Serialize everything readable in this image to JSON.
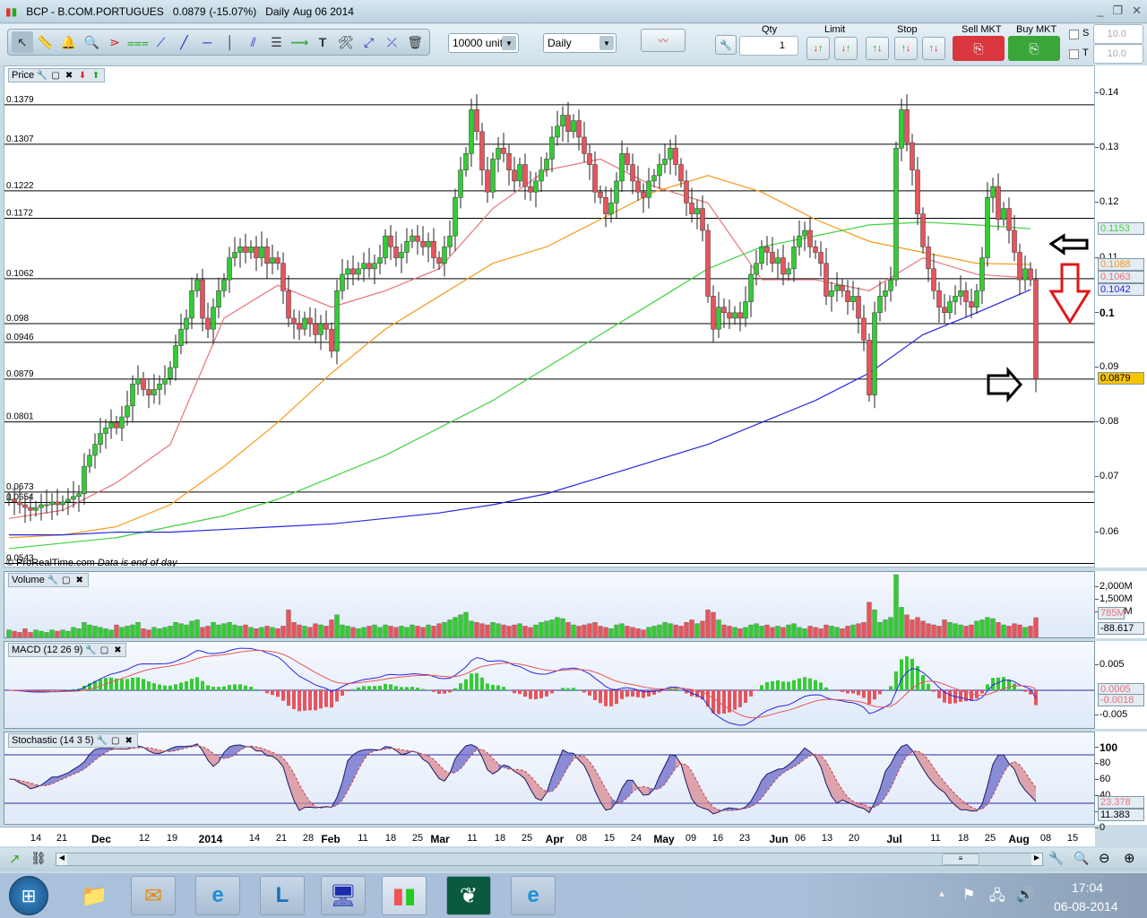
{
  "window": {
    "symbol": "BCP - B.COM.PORTUGUES",
    "last_price": "0.0879",
    "change": "(-15.07%)",
    "period": "Daily",
    "date": "Aug 06 2014",
    "controls": [
      "minimize",
      "restore",
      "close"
    ]
  },
  "toolbar": {
    "tools": [
      "pointer-icon",
      "ruler-icon",
      "alarm-bell-icon",
      "zoom-magnifier-icon",
      "fan-lines-icon",
      "channel-icon",
      "segment-icon",
      "line-icon",
      "horizontal-line-icon",
      "vertical-line-icon",
      "parallel-lines-icon",
      "fibonacci-icon",
      "trend-channel-icon",
      "text-icon",
      "tools-icon",
      "point-icon",
      "line-cross-icon",
      "trash-icon"
    ],
    "units": "10000 units",
    "timeframe": "Daily",
    "qty_label": "Qty",
    "qty_value": "1",
    "limit_label": "Limit",
    "stop_label": "Stop",
    "sell_label": "Sell MKT",
    "buy_label": "Buy MKT",
    "s_label": "S",
    "t_label": "T",
    "s_value": "10.0",
    "t_value": "10.0",
    "sell_color": "#d9363e",
    "buy_color": "#3aa63a"
  },
  "price_panel": {
    "title": "Price",
    "copyright": "© ProRealTime.com",
    "notice": "Data is end of day",
    "axis_ticks": [
      "0.14",
      "0.13",
      "0.12",
      "0.11",
      "0.1",
      "0.09",
      "0.08",
      "0.07",
      "0.06"
    ],
    "levels": [
      "0.1379",
      "0.1307",
      "0.1222",
      "0.1172",
      "0.1062",
      "0.098",
      "0.0946",
      "0.0879",
      "0.0801",
      "0.0673",
      "0.0654",
      "0.0543"
    ],
    "ma_tags": [
      {
        "value": "0.1153",
        "color": "#3fd43f"
      },
      {
        "value": "0.1088",
        "color": "#f59a1c"
      },
      {
        "value": "0.1063",
        "color": "#e8737a"
      },
      {
        "value": "0.1042",
        "color": "#2626e0"
      }
    ],
    "last_tag": "0.0879",
    "last_tag_color": "#f5c400"
  },
  "volume_panel": {
    "title": "Volume",
    "axis_ticks": [
      "2,000M",
      "1,500M",
      "1,000M"
    ],
    "tag_volume": "785M",
    "tag_value": "-88.617"
  },
  "macd_panel": {
    "title": "MACD (12 26 9)",
    "axis_ticks": [
      "0.005",
      "-0.005"
    ],
    "tag1": "0.0005",
    "tag2": "-0.0018"
  },
  "stoch_panel": {
    "title": "Stochastic (14 3 5)",
    "axis_ticks": [
      "100",
      "80",
      "60",
      "40",
      "20",
      "0"
    ],
    "tag1": "23.378",
    "tag2": "11.383"
  },
  "x_axis": {
    "labels": [
      "14",
      "21",
      "Dec",
      "12",
      "19",
      "2014",
      "14",
      "21",
      "28",
      "Feb",
      "11",
      "18",
      "25",
      "Mar",
      "11",
      "18",
      "25",
      "Apr",
      "08",
      "15",
      "24",
      "May",
      "09",
      "16",
      "23",
      "Jun",
      "06",
      "13",
      "20",
      "Jul",
      "11",
      "18",
      "25",
      "Aug",
      "08",
      "15"
    ]
  },
  "taskbar": {
    "apps": [
      "start-orb",
      "file-explorer",
      "outlook",
      "internet-explorer",
      "lync",
      "remote-terminal",
      "prorealtime",
      "app-green-leaf",
      "internet-explorer-2"
    ],
    "time": "17:04",
    "date": "06-08-2014"
  },
  "chart_data": {
    "type": "candlestick",
    "title": "BCP - B.COM.PORTUGUES",
    "ylim": [
      0.054,
      0.142
    ],
    "up_color": "#33cc33",
    "down_color": "#e8545c",
    "closes": [
      0.066,
      0.0655,
      0.065,
      0.0645,
      0.064,
      0.0645,
      0.065,
      0.065,
      0.0655,
      0.065,
      0.0655,
      0.066,
      0.0665,
      0.067,
      0.072,
      0.074,
      0.076,
      0.078,
      0.079,
      0.08,
      0.079,
      0.081,
      0.083,
      0.087,
      0.088,
      0.086,
      0.085,
      0.086,
      0.087,
      0.088,
      0.09,
      0.094,
      0.097,
      0.099,
      0.104,
      0.106,
      0.099,
      0.097,
      0.101,
      0.104,
      0.106,
      0.11,
      0.111,
      0.112,
      0.111,
      0.112,
      0.11,
      0.112,
      0.109,
      0.11,
      0.109,
      0.104,
      0.099,
      0.098,
      0.097,
      0.099,
      0.098,
      0.096,
      0.098,
      0.097,
      0.093,
      0.104,
      0.107,
      0.108,
      0.107,
      0.108,
      0.109,
      0.108,
      0.109,
      0.11,
      0.114,
      0.112,
      0.11,
      0.111,
      0.113,
      0.114,
      0.113,
      0.112,
      0.113,
      0.11,
      0.109,
      0.112,
      0.114,
      0.121,
      0.126,
      0.129,
      0.137,
      0.133,
      0.126,
      0.122,
      0.128,
      0.13,
      0.129,
      0.126,
      0.124,
      0.127,
      0.123,
      0.122,
      0.124,
      0.126,
      0.128,
      0.132,
      0.134,
      0.136,
      0.133,
      0.135,
      0.132,
      0.129,
      0.127,
      0.122,
      0.121,
      0.118,
      0.12,
      0.124,
      0.129,
      0.127,
      0.124,
      0.122,
      0.121,
      0.124,
      0.125,
      0.127,
      0.128,
      0.13,
      0.127,
      0.124,
      0.12,
      0.118,
      0.119,
      0.115,
      0.103,
      0.097,
      0.101,
      0.1,
      0.099,
      0.1,
      0.099,
      0.102,
      0.107,
      0.109,
      0.112,
      0.111,
      0.109,
      0.11,
      0.107,
      0.108,
      0.112,
      0.114,
      0.115,
      0.112,
      0.111,
      0.109,
      0.103,
      0.104,
      0.105,
      0.104,
      0.102,
      0.103,
      0.099,
      0.095,
      0.085,
      0.1,
      0.103,
      0.104,
      0.106,
      0.13,
      0.137,
      0.131,
      0.126,
      0.118,
      0.112,
      0.108,
      0.104,
      0.101,
      0.1,
      0.102,
      0.103,
      0.104,
      0.102,
      0.101,
      0.104,
      0.11,
      0.121,
      0.123,
      0.117,
      0.119,
      0.115,
      0.111,
      0.106,
      0.108,
      0.106,
      0.0879
    ],
    "volumes_m": [
      300,
      250,
      200,
      350,
      200,
      300,
      250,
      200,
      300,
      250,
      300,
      250,
      400,
      350,
      600,
      500,
      450,
      400,
      350,
      300,
      500,
      400,
      450,
      500,
      600,
      350,
      300,
      400,
      350,
      400,
      450,
      600,
      550,
      500,
      650,
      700,
      400,
      450,
      600,
      500,
      550,
      600,
      500,
      450,
      500,
      400,
      350,
      400,
      450,
      400,
      350,
      450,
      1100,
      600,
      500,
      450,
      400,
      550,
      500,
      450,
      700,
      900,
      500,
      450,
      400,
      350,
      400,
      450,
      500,
      400,
      500,
      450,
      400,
      450,
      400,
      500,
      450,
      400,
      500,
      450,
      550,
      600,
      700,
      800,
      900,
      1000,
      650,
      600,
      550,
      500,
      600,
      550,
      500,
      450,
      500,
      550,
      450,
      400,
      500,
      600,
      650,
      700,
      800,
      750,
      600,
      500,
      450,
      500,
      550,
      600,
      450,
      400,
      350,
      500,
      550,
      450,
      400,
      350,
      300,
      400,
      450,
      500,
      600,
      550,
      500,
      450,
      600,
      700,
      550,
      650,
      1100,
      1000,
      700,
      500,
      450,
      400,
      350,
      400,
      500,
      550,
      450,
      500,
      400,
      450,
      400,
      500,
      550,
      400,
      350,
      450,
      400,
      350,
      500,
      450,
      400,
      350,
      450,
      500,
      550,
      600,
      1400,
      1100,
      600,
      700,
      800,
      2500,
      1200,
      900,
      700,
      800,
      650,
      550,
      500,
      450,
      700,
      600,
      550,
      500,
      450,
      500,
      650,
      700,
      800,
      750,
      600,
      500,
      450,
      550,
      500,
      400,
      450,
      785
    ],
    "moving_averages": [
      {
        "color": "#e8737a",
        "values": [
          0.0625,
          0.064,
          0.069,
          0.076,
          0.099,
          0.105,
          0.101,
          0.104,
          0.108,
          0.119,
          0.126,
          0.128,
          0.123,
          0.12,
          0.106,
          0.106,
          0.104,
          0.11,
          0.107,
          0.1063
        ]
      },
      {
        "color": "#f59a1c",
        "values": [
          0.059,
          0.0595,
          0.061,
          0.065,
          0.072,
          0.08,
          0.089,
          0.097,
          0.103,
          0.109,
          0.112,
          0.117,
          0.122,
          0.125,
          0.122,
          0.117,
          0.113,
          0.111,
          0.109,
          0.1088
        ]
      },
      {
        "color": "#3fd43f",
        "values": [
          0.057,
          0.058,
          0.059,
          0.061,
          0.063,
          0.066,
          0.07,
          0.074,
          0.079,
          0.084,
          0.09,
          0.096,
          0.102,
          0.108,
          0.112,
          0.114,
          0.116,
          0.1165,
          0.116,
          0.1153
        ]
      },
      {
        "color": "#2626e0",
        "values": [
          0.0595,
          0.0595,
          0.06,
          0.06,
          0.0605,
          0.061,
          0.0615,
          0.0625,
          0.0635,
          0.065,
          0.067,
          0.07,
          0.073,
          0.076,
          0.08,
          0.084,
          0.089,
          0.096,
          0.1,
          0.1042
        ]
      }
    ],
    "annotations": [
      "arrow-left-black",
      "arrow-down-red",
      "arrow-right-black"
    ]
  }
}
